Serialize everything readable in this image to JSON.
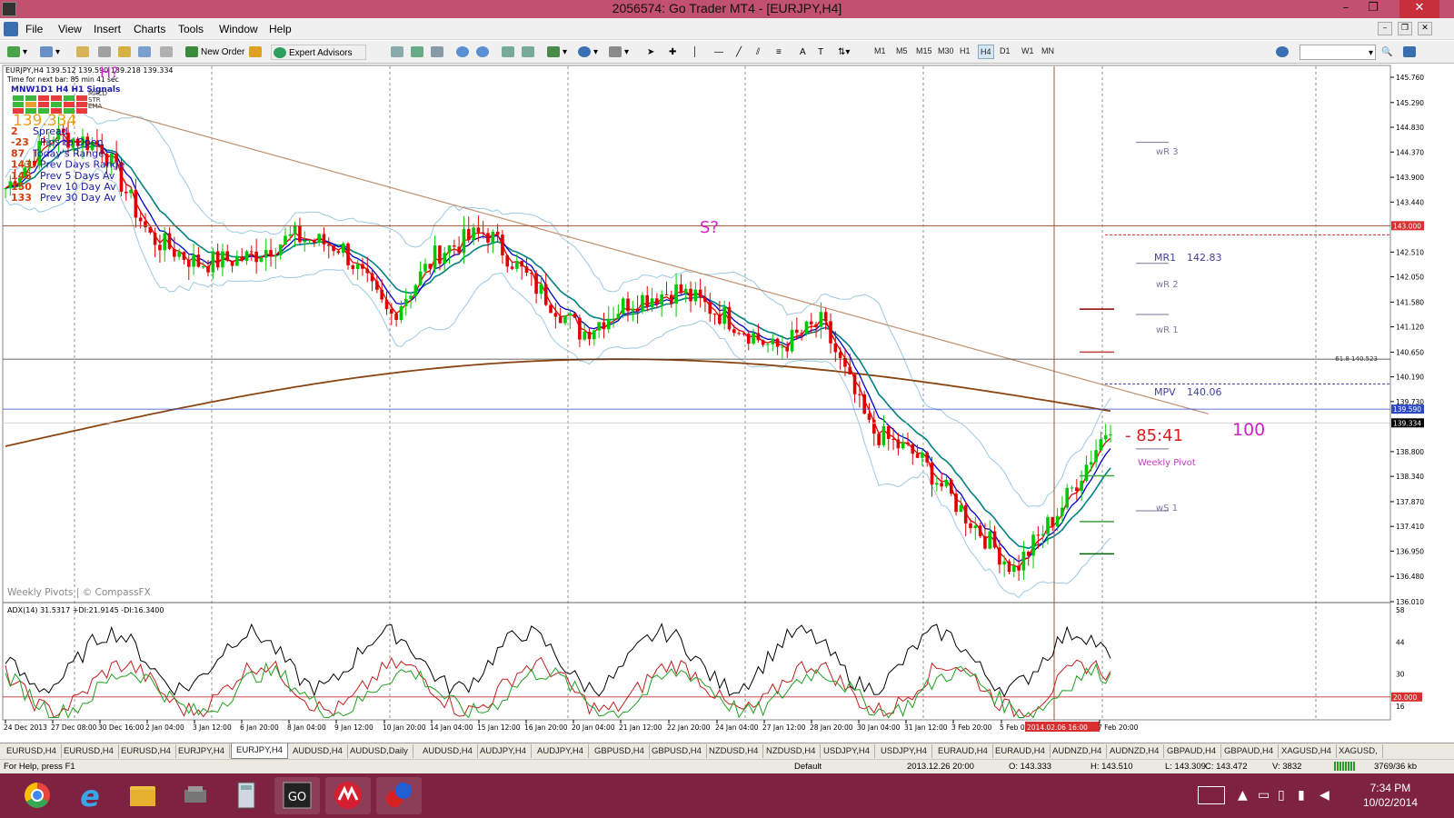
{
  "window": {
    "title": "2056574: Go Trader MT4 - [EURJPY,H4]",
    "min": "–",
    "max": "❐",
    "close": "✕"
  },
  "menu": [
    "File",
    "View",
    "Insert",
    "Charts",
    "Tools",
    "Window",
    "Help"
  ],
  "toolbar": {
    "new_order": "New Order",
    "expert_advisors": "Expert Advisors",
    "timeframes": [
      "M1",
      "M5",
      "M15",
      "M30",
      "H1",
      "H4",
      "D1",
      "W1",
      "MN"
    ],
    "selected_tf": "H4"
  },
  "chart": {
    "header": "EURJPY,H4  139.512 139.590 139.218 139.334",
    "timer": "Time for next bar: 85 min 41 sec",
    "signals_label": "MNW1D1 H4 H1  Signals",
    "signal_rows": [
      "MACD",
      "STR",
      "EMA"
    ],
    "big_price": "139.334",
    "stats": [
      {
        "v": "2",
        "l": "Spread"
      },
      {
        "v": "-23",
        "l": "Pips to Open"
      },
      {
        "v": "87",
        "l": "Today's Range"
      },
      {
        "v": "143",
        "l": "Prev Days Range"
      },
      {
        "v": "148",
        "l": "Prev 5 Days Av"
      },
      {
        "v": "150",
        "l": "Prev 10 Day Av"
      },
      {
        "v": "133",
        "l": "Prev 30 Day Av"
      }
    ],
    "annotations": {
      "h": "H?",
      "s": "S?",
      "timer_big": "- 85:41",
      "hundred": "100",
      "weekly_pivots": "Weekly Pivots | © CompassFX"
    },
    "pivots": {
      "wr3": "wR 3",
      "mr1": "MR1",
      "mr1_val": "142.83",
      "wr2": "wR 2",
      "wr1": "wR 1",
      "mpv": "MPV",
      "mpv_val": "140.06",
      "weekly_pivot": "Weekly Pivot",
      "ws1": "wS 1",
      "fib": "61.8 140.523"
    },
    "price_axis": [
      "145.760",
      "145.290",
      "144.830",
      "144.370",
      "143.900",
      "143.440",
      "143.000",
      "142.510",
      "142.050",
      "141.580",
      "141.120",
      "140.650",
      "140.190",
      "139.730",
      "139.590",
      "139.334",
      "138.800",
      "138.340",
      "137.870",
      "137.410",
      "136.950",
      "136.480",
      "136.010"
    ],
    "time_axis": [
      "24 Dec 2013",
      "27 Dec 08:00",
      "30 Dec 16:00",
      "2 Jan 04:00",
      "3 Jan 12:00",
      "6 Jan 20:00",
      "8 Jan 04:00",
      "9 Jan 12:00",
      "10 Jan 20:00",
      "14 Jan 04:00",
      "15 Jan 12:00",
      "16 Jan 20:00",
      "20 Jan 04:00",
      "21 Jan 12:00",
      "22 Jan 20:00",
      "24 Jan 04:00",
      "27 Jan 12:00",
      "28 Jan 20:00",
      "30 Jan 04:00",
      "31 Jan 12:00",
      "3 Feb 20:00",
      "5 Feb 04:00",
      "2014.02.06 16:00",
      "7 Feb 20:00"
    ],
    "price_markers": {
      "level143": "143.000",
      "blue": "139.590",
      "last": "139.334"
    },
    "adx_label": "ADX(14) 31.5317 +DI:21.9145 -DI:16.3400",
    "adx_axis": [
      "58",
      "44",
      "30",
      "20.000",
      "16"
    ]
  },
  "chart_data": {
    "type": "line",
    "title": "EURJPY,H4",
    "xlabel": "",
    "ylabel": "",
    "x": [
      "24 Dec 2013",
      "27 Dec 08:00",
      "30 Dec 16:00",
      "2 Jan 04:00",
      "3 Jan 12:00",
      "6 Jan 20:00",
      "8 Jan 04:00",
      "9 Jan 12:00",
      "10 Jan 20:00",
      "14 Jan 04:00",
      "15 Jan 12:00",
      "16 Jan 20:00",
      "20 Jan 04:00",
      "21 Jan 12:00",
      "22 Jan 20:00",
      "24 Jan 04:00",
      "27 Jan 12:00",
      "28 Jan 20:00",
      "30 Jan 04:00",
      "31 Jan 12:00",
      "3 Feb 20:00",
      "5 Feb 04:00",
      "6 Feb 16:00",
      "7 Feb 20:00"
    ],
    "ylim": [
      136.01,
      145.76
    ],
    "series": [
      {
        "values": [
          143.7,
          144.7,
          144.5,
          142.8,
          142.3,
          142.4,
          142.8,
          142.6,
          141.3,
          142.5,
          142.9,
          141.9,
          141.0,
          141.6,
          141.8,
          141.3,
          140.7,
          141.2,
          139.2,
          138.7,
          137.6,
          136.6,
          137.8,
          139.334
        ]
      }
    ]
  },
  "tabs": [
    "EURUSD,H4",
    "EURUSD,H4",
    "EURUSD,H4",
    "EURJPY,H4",
    "EURJPY,H4",
    "AUDUSD,H4",
    "AUDUSD,Daily",
    "AUDUSD,H4",
    "AUDJPY,H4",
    "AUDJPY,H4",
    "GBPUSD,H4",
    "GBPUSD,H4",
    "NZDUSD,H4",
    "NZDUSD,H4",
    "USDJPY,H4",
    "USDJPY,H4",
    "EURAUD,H4",
    "EURAUD,H4",
    "AUDNZD,H4",
    "AUDNZD,H4",
    "GBPAUD,H4",
    "GBPAUD,H4",
    "XAGUSD,H4",
    "XAGUSD,"
  ],
  "active_tab": 4,
  "status": {
    "help": "For Help, press F1",
    "profile": "Default",
    "time": "2013.12.26 20:00",
    "open": "O: 143.333",
    "high": "H: 143.510",
    "low": "L: 143.309",
    "close": "C: 143.472",
    "volume": "V: 3832",
    "traffic": "3769/36 kb"
  },
  "taskbar": {
    "time": "7:34 PM",
    "date": "10/02/2014"
  }
}
